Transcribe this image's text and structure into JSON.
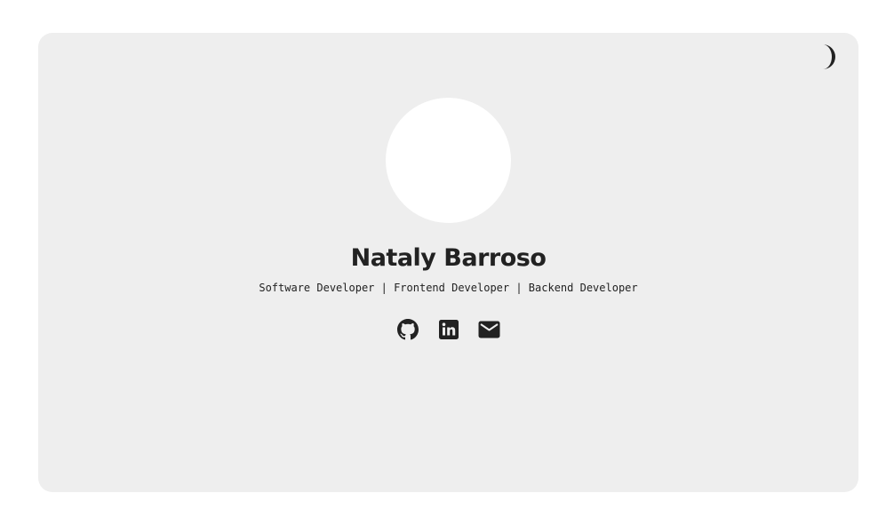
{
  "profile": {
    "name": "Nataly Barroso",
    "subtitle": "Software Developer | Frontend Developer | Backend Developer"
  },
  "theme_toggle": {
    "icon": "moon-icon"
  },
  "social_links": [
    {
      "icon": "github-icon"
    },
    {
      "icon": "linkedin-icon"
    },
    {
      "icon": "email-icon"
    }
  ],
  "colors": {
    "page_background": "#ffffff",
    "card_background": "#eeeeee",
    "text": "#222222",
    "avatar_background": "#ffffff"
  }
}
